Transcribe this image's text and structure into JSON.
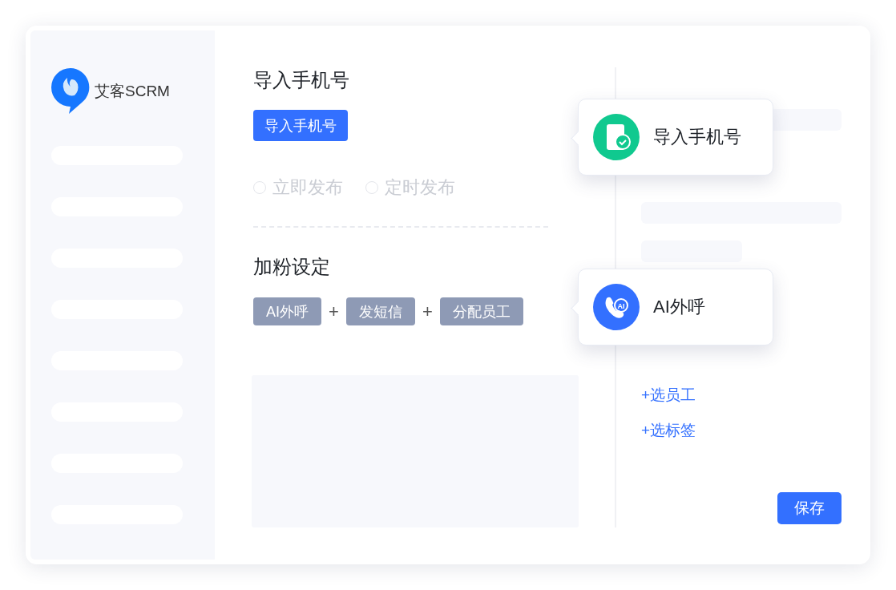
{
  "brand": {
    "name": "艾客SCRM"
  },
  "import_section": {
    "title": "导入手机号",
    "button": "导入手机号"
  },
  "publish_options": [
    {
      "label": "立即发布",
      "selected": false
    },
    {
      "label": "定时发布",
      "selected": false
    }
  ],
  "fans_section": {
    "title": "加粉设定"
  },
  "steps": [
    {
      "kind": "tag",
      "label": "AI外呼"
    },
    {
      "kind": "plus",
      "label": "+"
    },
    {
      "kind": "tag",
      "label": "发短信"
    },
    {
      "kind": "plus",
      "label": "+"
    },
    {
      "kind": "tag",
      "label": "分配员工"
    }
  ],
  "callouts": [
    {
      "kind": "phone-check",
      "title": "导入手机号",
      "color": "#10c98f"
    },
    {
      "kind": "ai-call",
      "title": "AI外呼",
      "color": "#3370ff",
      "icon_text": "AI"
    }
  ],
  "links": [
    "+选员工",
    "+选标签"
  ],
  "save_button": "保存"
}
